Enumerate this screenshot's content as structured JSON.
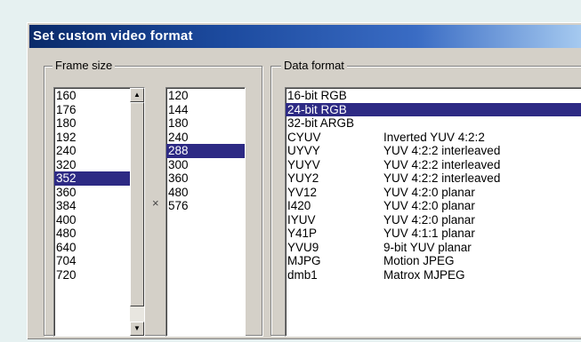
{
  "dialog": {
    "title": "Set custom video format"
  },
  "frame_size": {
    "label": "Frame size",
    "times_symbol": "×",
    "widths": [
      "160",
      "176",
      "180",
      "192",
      "240",
      "320",
      "352",
      "360",
      "384",
      "400",
      "480",
      "640",
      "704",
      "720"
    ],
    "selected_width": "352",
    "heights": [
      "120",
      "144",
      "180",
      "240",
      "288",
      "300",
      "360",
      "480",
      "576"
    ],
    "selected_height": "288"
  },
  "data_format": {
    "label": "Data format",
    "items": [
      {
        "code": "16-bit RGB",
        "desc": ""
      },
      {
        "code": "24-bit RGB",
        "desc": ""
      },
      {
        "code": "32-bit ARGB",
        "desc": ""
      },
      {
        "code": "CYUV",
        "desc": "Inverted YUV 4:2:2"
      },
      {
        "code": "UYVY",
        "desc": "YUV 4:2:2 interleaved"
      },
      {
        "code": "YUYV",
        "desc": "YUV 4:2:2 interleaved"
      },
      {
        "code": "YUY2",
        "desc": "YUV 4:2:2 interleaved"
      },
      {
        "code": "YV12",
        "desc": "YUV 4:2:0 planar"
      },
      {
        "code": "I420",
        "desc": "YUV 4:2:0 planar"
      },
      {
        "code": "IYUV",
        "desc": "YUV 4:2:0 planar"
      },
      {
        "code": "Y41P",
        "desc": "YUV 4:1:1 planar"
      },
      {
        "code": "YVU9",
        "desc": "9-bit YUV planar"
      },
      {
        "code": "MJPG",
        "desc": "Motion JPEG"
      },
      {
        "code": "dmb1",
        "desc": "Matrox MJPEG"
      }
    ],
    "selected": "24-bit RGB"
  },
  "colors": {
    "selection": "#2d2a84",
    "title_start": "#0a2a6a",
    "title_end": "#a6caf0",
    "page_background": "#e6f1f1",
    "dialog_face": "#d4d0c8"
  }
}
